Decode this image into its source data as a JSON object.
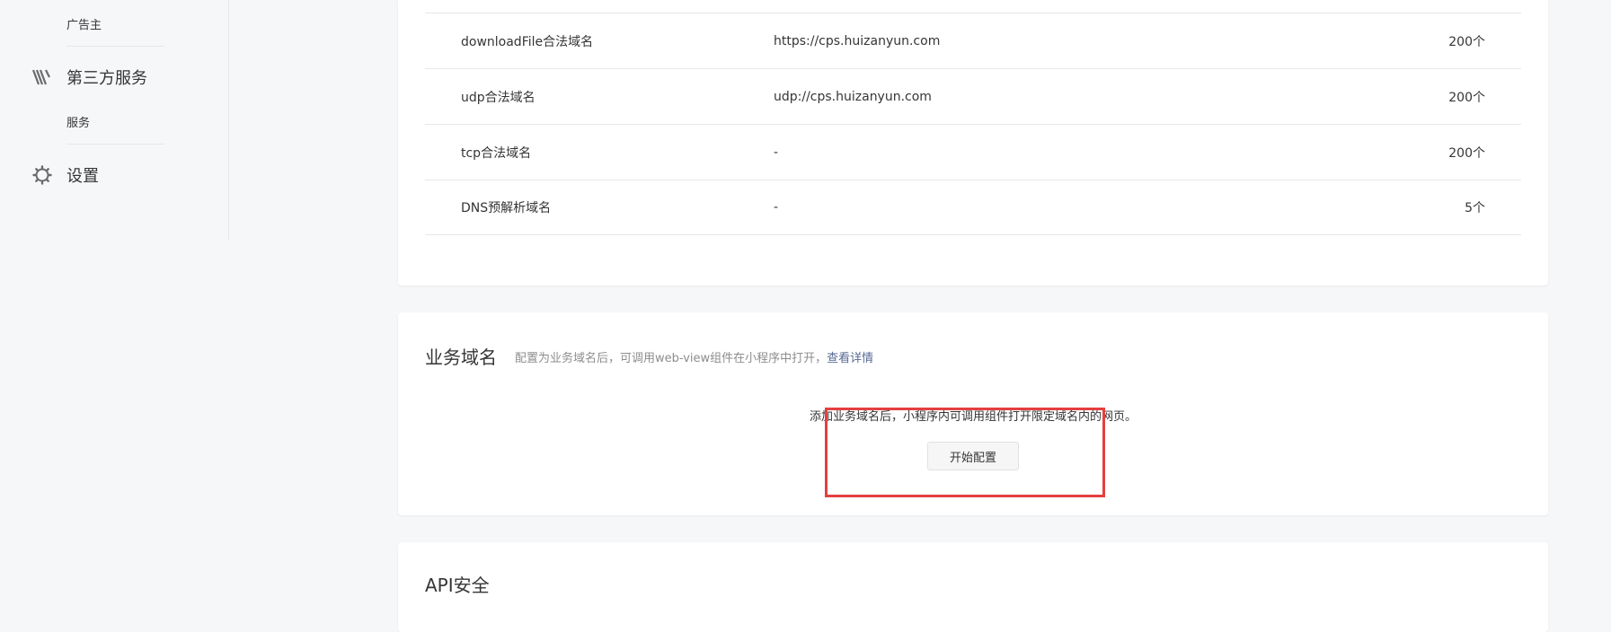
{
  "sidebar": {
    "advertiser_label": "广告主",
    "third_party": {
      "title": "第三方服务",
      "icon": "third-party-icon",
      "sub_label": "服务"
    },
    "settings": {
      "title": "设置",
      "icon": "gear-icon"
    }
  },
  "domain_table": {
    "rows": [
      {
        "name": "downloadFile合法域名",
        "value": "https://cps.huizanyun.com",
        "limit": "200个"
      },
      {
        "name": "udp合法域名",
        "value": "udp://cps.huizanyun.com",
        "limit": "200个"
      },
      {
        "name": "tcp合法域名",
        "value": "-",
        "limit": "200个"
      },
      {
        "name": "DNS预解析域名",
        "value": "-",
        "limit": "5个"
      }
    ]
  },
  "business_domain": {
    "title": "业务域名",
    "description": "配置为业务域名后，可调用web-view组件在小程序中打开，",
    "details_link": "查看详情",
    "tip": "添加业务域名后，小程序内可调用组件打开限定域名内的网页。",
    "start_button": "开始配置"
  },
  "api_security": {
    "title": "API安全"
  },
  "colors": {
    "highlight": "#e53f3f",
    "link": "#576b95",
    "page_bg": "#f6f7f9"
  }
}
